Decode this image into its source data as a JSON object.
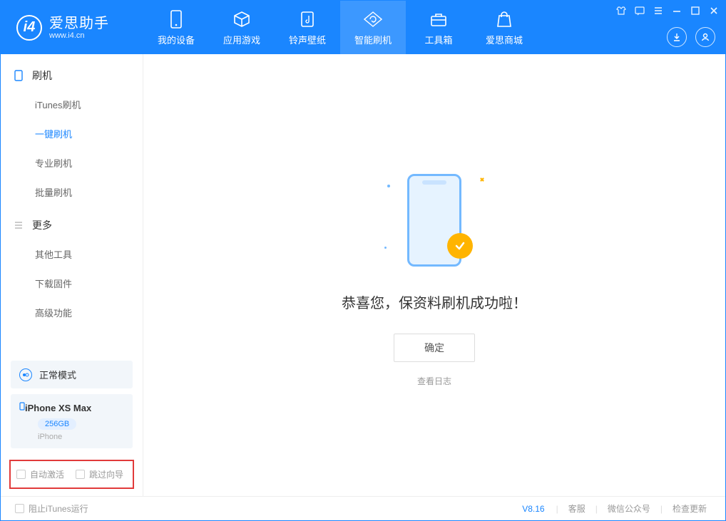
{
  "app": {
    "logo_title": "爱思助手",
    "logo_sub": "www.i4.cn"
  },
  "nav": {
    "tabs": [
      {
        "label": "我的设备",
        "icon": "device"
      },
      {
        "label": "应用游戏",
        "icon": "cube"
      },
      {
        "label": "铃声壁纸",
        "icon": "music"
      },
      {
        "label": "智能刷机",
        "icon": "refresh",
        "active": true
      },
      {
        "label": "工具箱",
        "icon": "toolbox"
      },
      {
        "label": "爱思商城",
        "icon": "bag"
      }
    ]
  },
  "sidebar": {
    "section1": {
      "title": "刷机",
      "items": [
        "iTunes刷机",
        "一键刷机",
        "专业刷机",
        "批量刷机"
      ],
      "active_index": 1
    },
    "section2": {
      "title": "更多",
      "items": [
        "其他工具",
        "下载固件",
        "高级功能"
      ]
    },
    "mode_card": {
      "label": "正常模式"
    },
    "device_card": {
      "name": "iPhone XS Max",
      "storage": "256GB",
      "type": "iPhone"
    },
    "checkboxes": {
      "auto_activate": "自动激活",
      "skip_guide": "跳过向导"
    }
  },
  "main": {
    "success_text": "恭喜您，保资料刷机成功啦！",
    "ok_button": "确定",
    "log_link": "查看日志"
  },
  "footer": {
    "block_itunes": "阻止iTunes运行",
    "version": "V8.16",
    "links": [
      "客服",
      "微信公众号",
      "检查更新"
    ]
  }
}
